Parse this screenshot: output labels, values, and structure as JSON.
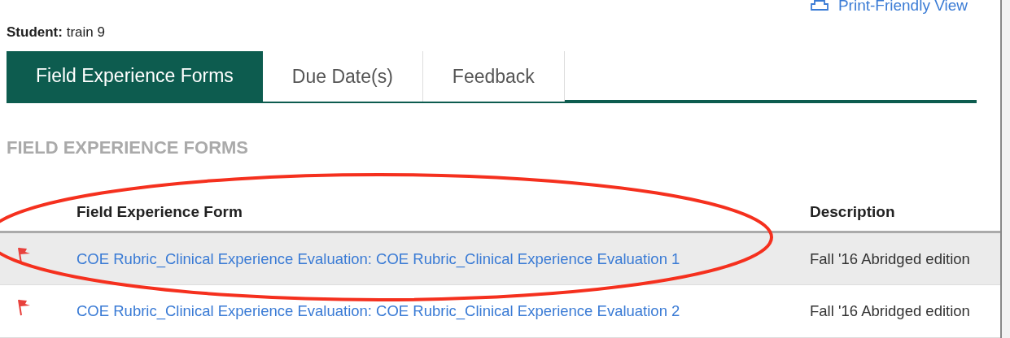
{
  "print_link": "Print-Friendly View",
  "student": {
    "label": "Student:",
    "value": "train 9"
  },
  "tabs": [
    {
      "label": "Field Experience Forms",
      "selected": true
    },
    {
      "label": "Due Date(s)",
      "selected": false
    },
    {
      "label": "Feedback",
      "selected": false
    }
  ],
  "section_title": "FIELD EXPERIENCE FORMS",
  "table": {
    "columns": [
      "Field Experience Form",
      "Description"
    ],
    "rows": [
      {
        "flagged": true,
        "selected": true,
        "form": "COE Rubric_Clinical Experience Evaluation: COE Rubric_Clinical Experience Evaluation 1",
        "description": "Fall '16 Abridged edition"
      },
      {
        "flagged": true,
        "selected": false,
        "form": "COE Rubric_Clinical Experience Evaluation: COE Rubric_Clinical Experience Evaluation 2",
        "description": "Fall '16 Abridged edition"
      }
    ]
  }
}
